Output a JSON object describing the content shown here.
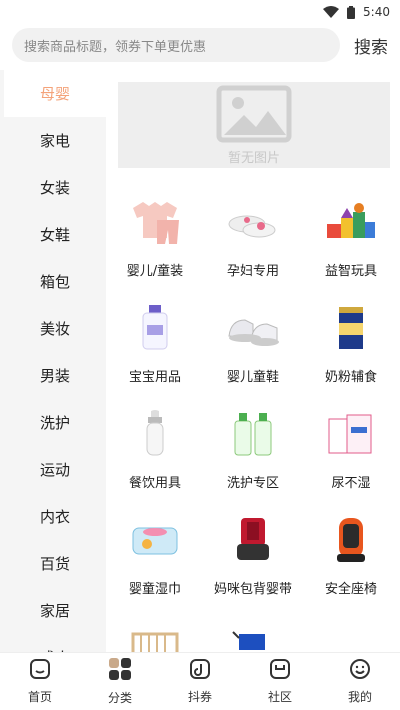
{
  "status_bar": {
    "time": "5:40",
    "icons": [
      "wifi-icon",
      "battery-icon"
    ]
  },
  "search": {
    "placeholder": "搜索商品标题，领券下单更优惠",
    "button_label": "搜索"
  },
  "sidebar": {
    "active_index": 0,
    "items": [
      {
        "label": "母婴"
      },
      {
        "label": "家电"
      },
      {
        "label": "女装"
      },
      {
        "label": "女鞋"
      },
      {
        "label": "箱包"
      },
      {
        "label": "美妆"
      },
      {
        "label": "男装"
      },
      {
        "label": "洗护"
      },
      {
        "label": "运动"
      },
      {
        "label": "内衣"
      },
      {
        "label": "百货"
      },
      {
        "label": "家居"
      },
      {
        "label": "成人"
      }
    ]
  },
  "banner": {
    "text": "暂无图片",
    "icon": "image-placeholder-icon"
  },
  "categories": [
    {
      "label": "婴儿/童装",
      "icon": "baby-clothes-icon"
    },
    {
      "label": "孕妇专用",
      "icon": "maternity-shoes-icon"
    },
    {
      "label": "益智玩具",
      "icon": "building-blocks-icon"
    },
    {
      "label": "宝宝用品",
      "icon": "baby-lotion-icon"
    },
    {
      "label": "婴儿童鞋",
      "icon": "baby-shoes-icon"
    },
    {
      "label": "奶粉辅食",
      "icon": "milk-powder-icon"
    },
    {
      "label": "餐饮用具",
      "icon": "baby-bottle-icon"
    },
    {
      "label": "洗护专区",
      "icon": "detergent-icon"
    },
    {
      "label": "尿不湿",
      "icon": "diapers-icon"
    },
    {
      "label": "婴童湿巾",
      "icon": "wet-wipes-icon"
    },
    {
      "label": "妈咪包背婴带",
      "icon": "baby-carrier-icon"
    },
    {
      "label": "安全座椅",
      "icon": "car-seat-icon"
    },
    {
      "label": "",
      "icon": "crib-icon"
    },
    {
      "label": "",
      "icon": "stroller-icon"
    }
  ],
  "tabbar": {
    "active_index": 1,
    "items": [
      {
        "label": "首页",
        "icon": "home-icon"
      },
      {
        "label": "分类",
        "icon": "category-icon"
      },
      {
        "label": "抖券",
        "icon": "douyin-coupon-icon"
      },
      {
        "label": "社区",
        "icon": "community-icon"
      },
      {
        "label": "我的",
        "icon": "profile-icon"
      }
    ]
  },
  "colors": {
    "accent": "#f4a37a",
    "sidebar_bg": "#f5f5f5",
    "search_bg": "#f1f1f1"
  }
}
